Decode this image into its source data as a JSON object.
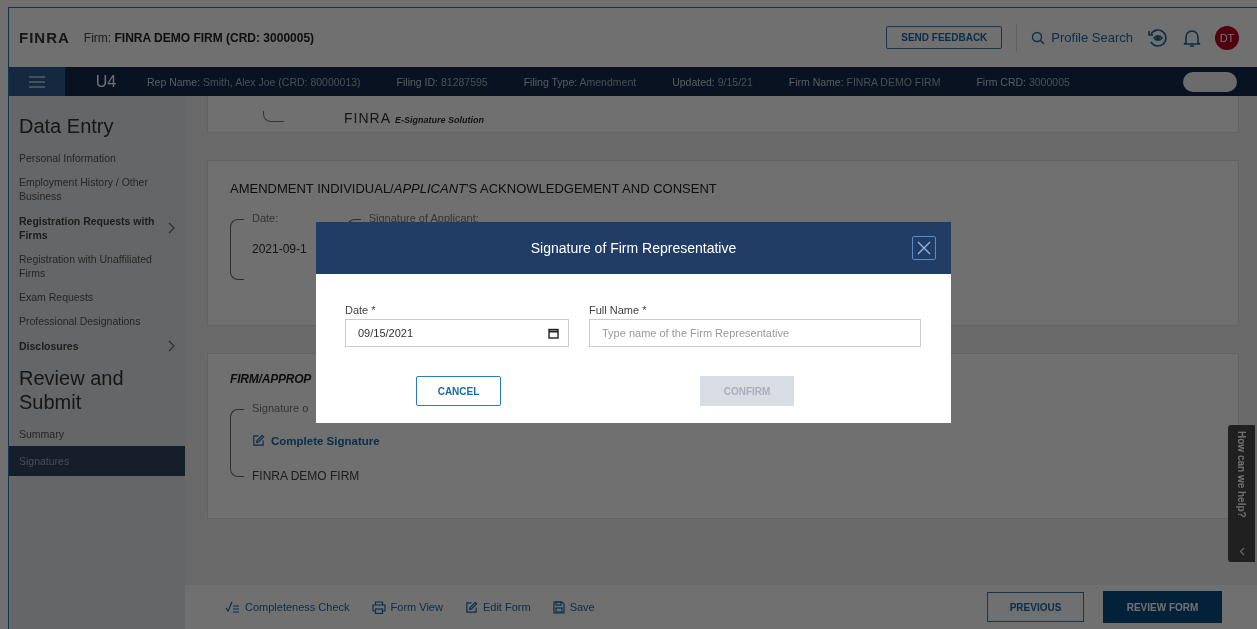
{
  "header": {
    "logo": "FINRA",
    "firm_label": "Firm:",
    "firm_value": "FINRA DEMO FIRM (CRD: 3000005)",
    "feedback_button": "SEND FEEDBACK",
    "search_link": "Profile Search",
    "avatar": "DT"
  },
  "filing_bar": {
    "form": "U4",
    "fields": [
      {
        "label": "Rep Name:",
        "value": "Smith, Alex Joe (CRD: 80000013)"
      },
      {
        "label": "Filing ID:",
        "value": "81287595"
      },
      {
        "label": "Filing Type:",
        "value": "Amendment"
      },
      {
        "label": "Updated:",
        "value": "9/15/21"
      },
      {
        "label": "Firm Name:",
        "value": "FINRA DEMO FIRM"
      },
      {
        "label": "Firm CRD:",
        "value": "3000005"
      }
    ],
    "toggle": {
      "on": false
    }
  },
  "sidebar": {
    "sections": [
      {
        "heading": "Data Entry",
        "items": [
          {
            "label": "Personal Information",
            "expandable": false,
            "selected": false
          },
          {
            "label": "Employment History / Other Business",
            "expandable": false,
            "selected": false
          },
          {
            "label": "Registration Requests with Firms",
            "expandable": true,
            "selected": false
          },
          {
            "label": "Registration with Unaffiliated Firms",
            "expandable": false,
            "selected": false
          },
          {
            "label": "Exam Requests",
            "expandable": false,
            "selected": false
          },
          {
            "label": "Professional Designations",
            "expandable": false,
            "selected": false
          },
          {
            "label": "Disclosures",
            "expandable": true,
            "selected": false
          }
        ]
      },
      {
        "heading": "Review and Submit",
        "items": [
          {
            "label": "Summary",
            "expandable": false,
            "selected": false
          },
          {
            "label": "Signatures",
            "expandable": false,
            "selected": true
          }
        ]
      }
    ]
  },
  "content": {
    "esignature_logo": "FINRA",
    "esignature_caption": "E-Signature Solution",
    "sections": [
      {
        "title": "AMENDMENT INDIVIDUAL/*APPLICANT*'S ACKNOWLEDGEMENT AND CONSENT",
        "italic": false,
        "fields": [
          {
            "label": "Date:",
            "value": "2021-09-1"
          },
          {
            "label": "Signature of Applicant:"
          }
        ]
      },
      {
        "title": "FIRM/APPROP",
        "italic": true,
        "fields": [
          {
            "label": "Signature o",
            "link": "Complete Signature",
            "value": "FINRA DEMO FIRM"
          }
        ]
      }
    ]
  },
  "modal": {
    "title": "Signature of Firm Representative",
    "date_label": "Date *",
    "date_value": "09/15/2021",
    "name_label": "Full Name *",
    "name_placeholder": "Type name of the Firm Representative",
    "cancel_button": "CANCEL",
    "confirm_button": {
      "label": "CONFIRM",
      "disabled": true
    }
  },
  "help_tab": {
    "label": "How can we help?"
  },
  "bottom_bar": {
    "tools": [
      {
        "kind": "check",
        "label": "Completeness Check"
      },
      {
        "kind": "print",
        "label": "Form View"
      },
      {
        "kind": "edit",
        "label": "Edit Form"
      },
      {
        "kind": "save",
        "label": "Save"
      }
    ],
    "previous_button": "PREVIOUS",
    "review_button": "REVIEW FORM"
  }
}
